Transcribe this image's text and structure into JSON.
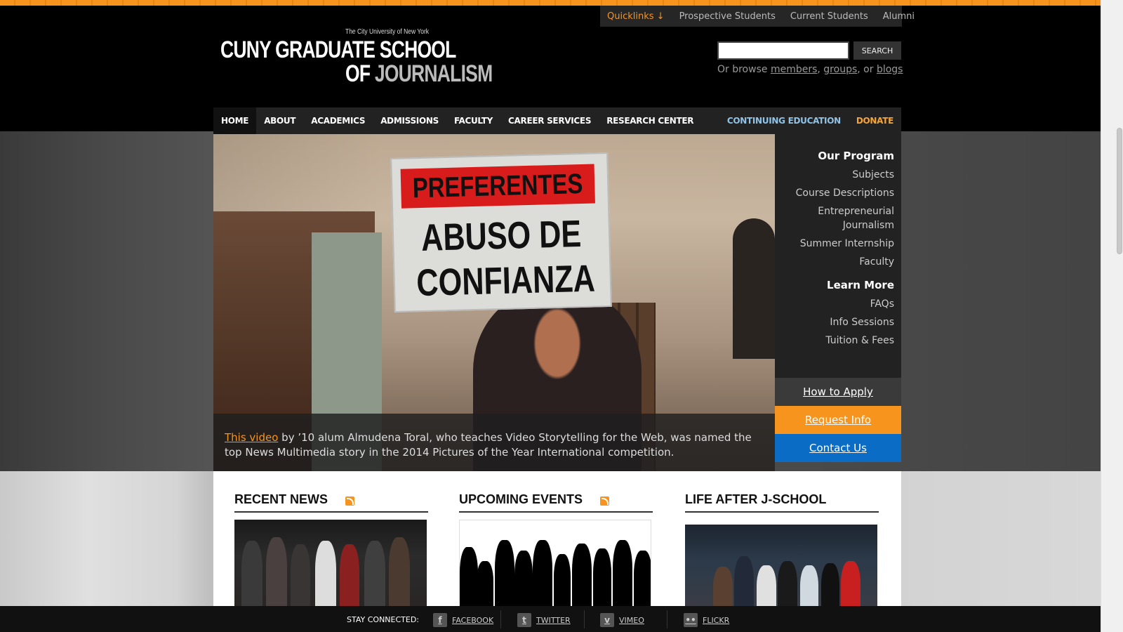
{
  "quicklinks": {
    "toggle": "Quicklinks ↓",
    "links": [
      "Prospective Students",
      "Current Students",
      "Alumni"
    ]
  },
  "logo": {
    "university": "The City University of New York",
    "line1": "CUNY GRADUATE SCHOOL",
    "line2_of": "OF",
    "line2_journalism": "JOURNALISM"
  },
  "search": {
    "value": "",
    "button": "SEARCH",
    "browse_prefix": "Or browse",
    "members": "members",
    "comma1": ",",
    "groups": "groups",
    "or": ", or",
    "blogs": "blogs"
  },
  "nav": {
    "items": [
      "HOME",
      "ABOUT",
      "ACADEMICS",
      "ADMISSIONS",
      "FACULTY",
      "CAREER SERVICES",
      "RESEARCH CENTER"
    ],
    "continuing": "CONTINUING EDUCATION",
    "donate": "DONATE"
  },
  "hero": {
    "sign_top": "PREFERENTES",
    "sign_line2": "ABUSO DE",
    "sign_line3": "CONFIANZA",
    "caption_link": "This video",
    "caption_text": " by ’10 alum Almudena Toral, who teaches Video Storytelling for the Web, was named the top News Multimedia story in the 2014 Pictures of the Year International competition."
  },
  "sidebar": {
    "program_heading": "Our Program",
    "program_links": [
      "Subjects",
      "Course Descriptions",
      "Entrepreneurial Journalism",
      "Summer Internship",
      "Faculty"
    ],
    "learn_heading": "Learn More",
    "learn_links": [
      "FAQs",
      "Info Sessions",
      "Tuition & Fees"
    ],
    "how_to_apply": "How to Apply",
    "request_info": "Request Info",
    "contact_us": "Contact Us"
  },
  "sections": {
    "recent_news": "RECENT NEWS",
    "upcoming_events": "UPCOMING EVENTS",
    "life_after": "LIFE AFTER J-SCHOOL"
  },
  "footer": {
    "stay_connected": "STAY CONNECTED:",
    "facebook": "FACEBOOK",
    "twitter": "TWITTER",
    "vimeo": "VIMEO",
    "flickr": "FLICKR"
  },
  "colors": {
    "accent_orange": "#f7941d",
    "contact_blue": "#0b6cc6",
    "continuing_blue": "#8fc3e8"
  },
  "icons": [
    "rss-icon",
    "facebook-icon",
    "twitter-icon",
    "vimeo-icon",
    "flickr-icon"
  ]
}
